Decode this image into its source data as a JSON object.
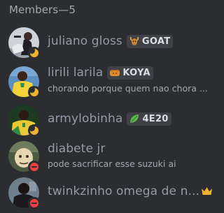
{
  "header": {
    "title": "Members—5"
  },
  "members": [
    {
      "name": "juliano gloss",
      "status": "idle",
      "tag": {
        "icon": "goat-icon",
        "text": "GOAT"
      },
      "activity": ""
    },
    {
      "name": "lirili larila",
      "status": "idle",
      "tag": {
        "icon": "bread-icon",
        "text": "KOYA"
      },
      "activity": "chorando porque quem nao chora ..."
    },
    {
      "name": "armylobinha",
      "status": "idle",
      "tag": {
        "icon": "leaf-icon",
        "text": "4E20"
      },
      "activity": ""
    },
    {
      "name": "diabete jr",
      "status": "dnd",
      "tag": null,
      "activity": "pode sacrificar esse suzuki ai"
    },
    {
      "name": "twinkzinho omega de n...",
      "status": "dnd",
      "tag": null,
      "activity": "",
      "owner_icon": "crown-icon"
    }
  ],
  "colors": {
    "background": "#2b2d31",
    "name": "#949ba4",
    "idle": "#f0b232",
    "dnd": "#f23f43",
    "crown": "#f0b232"
  }
}
